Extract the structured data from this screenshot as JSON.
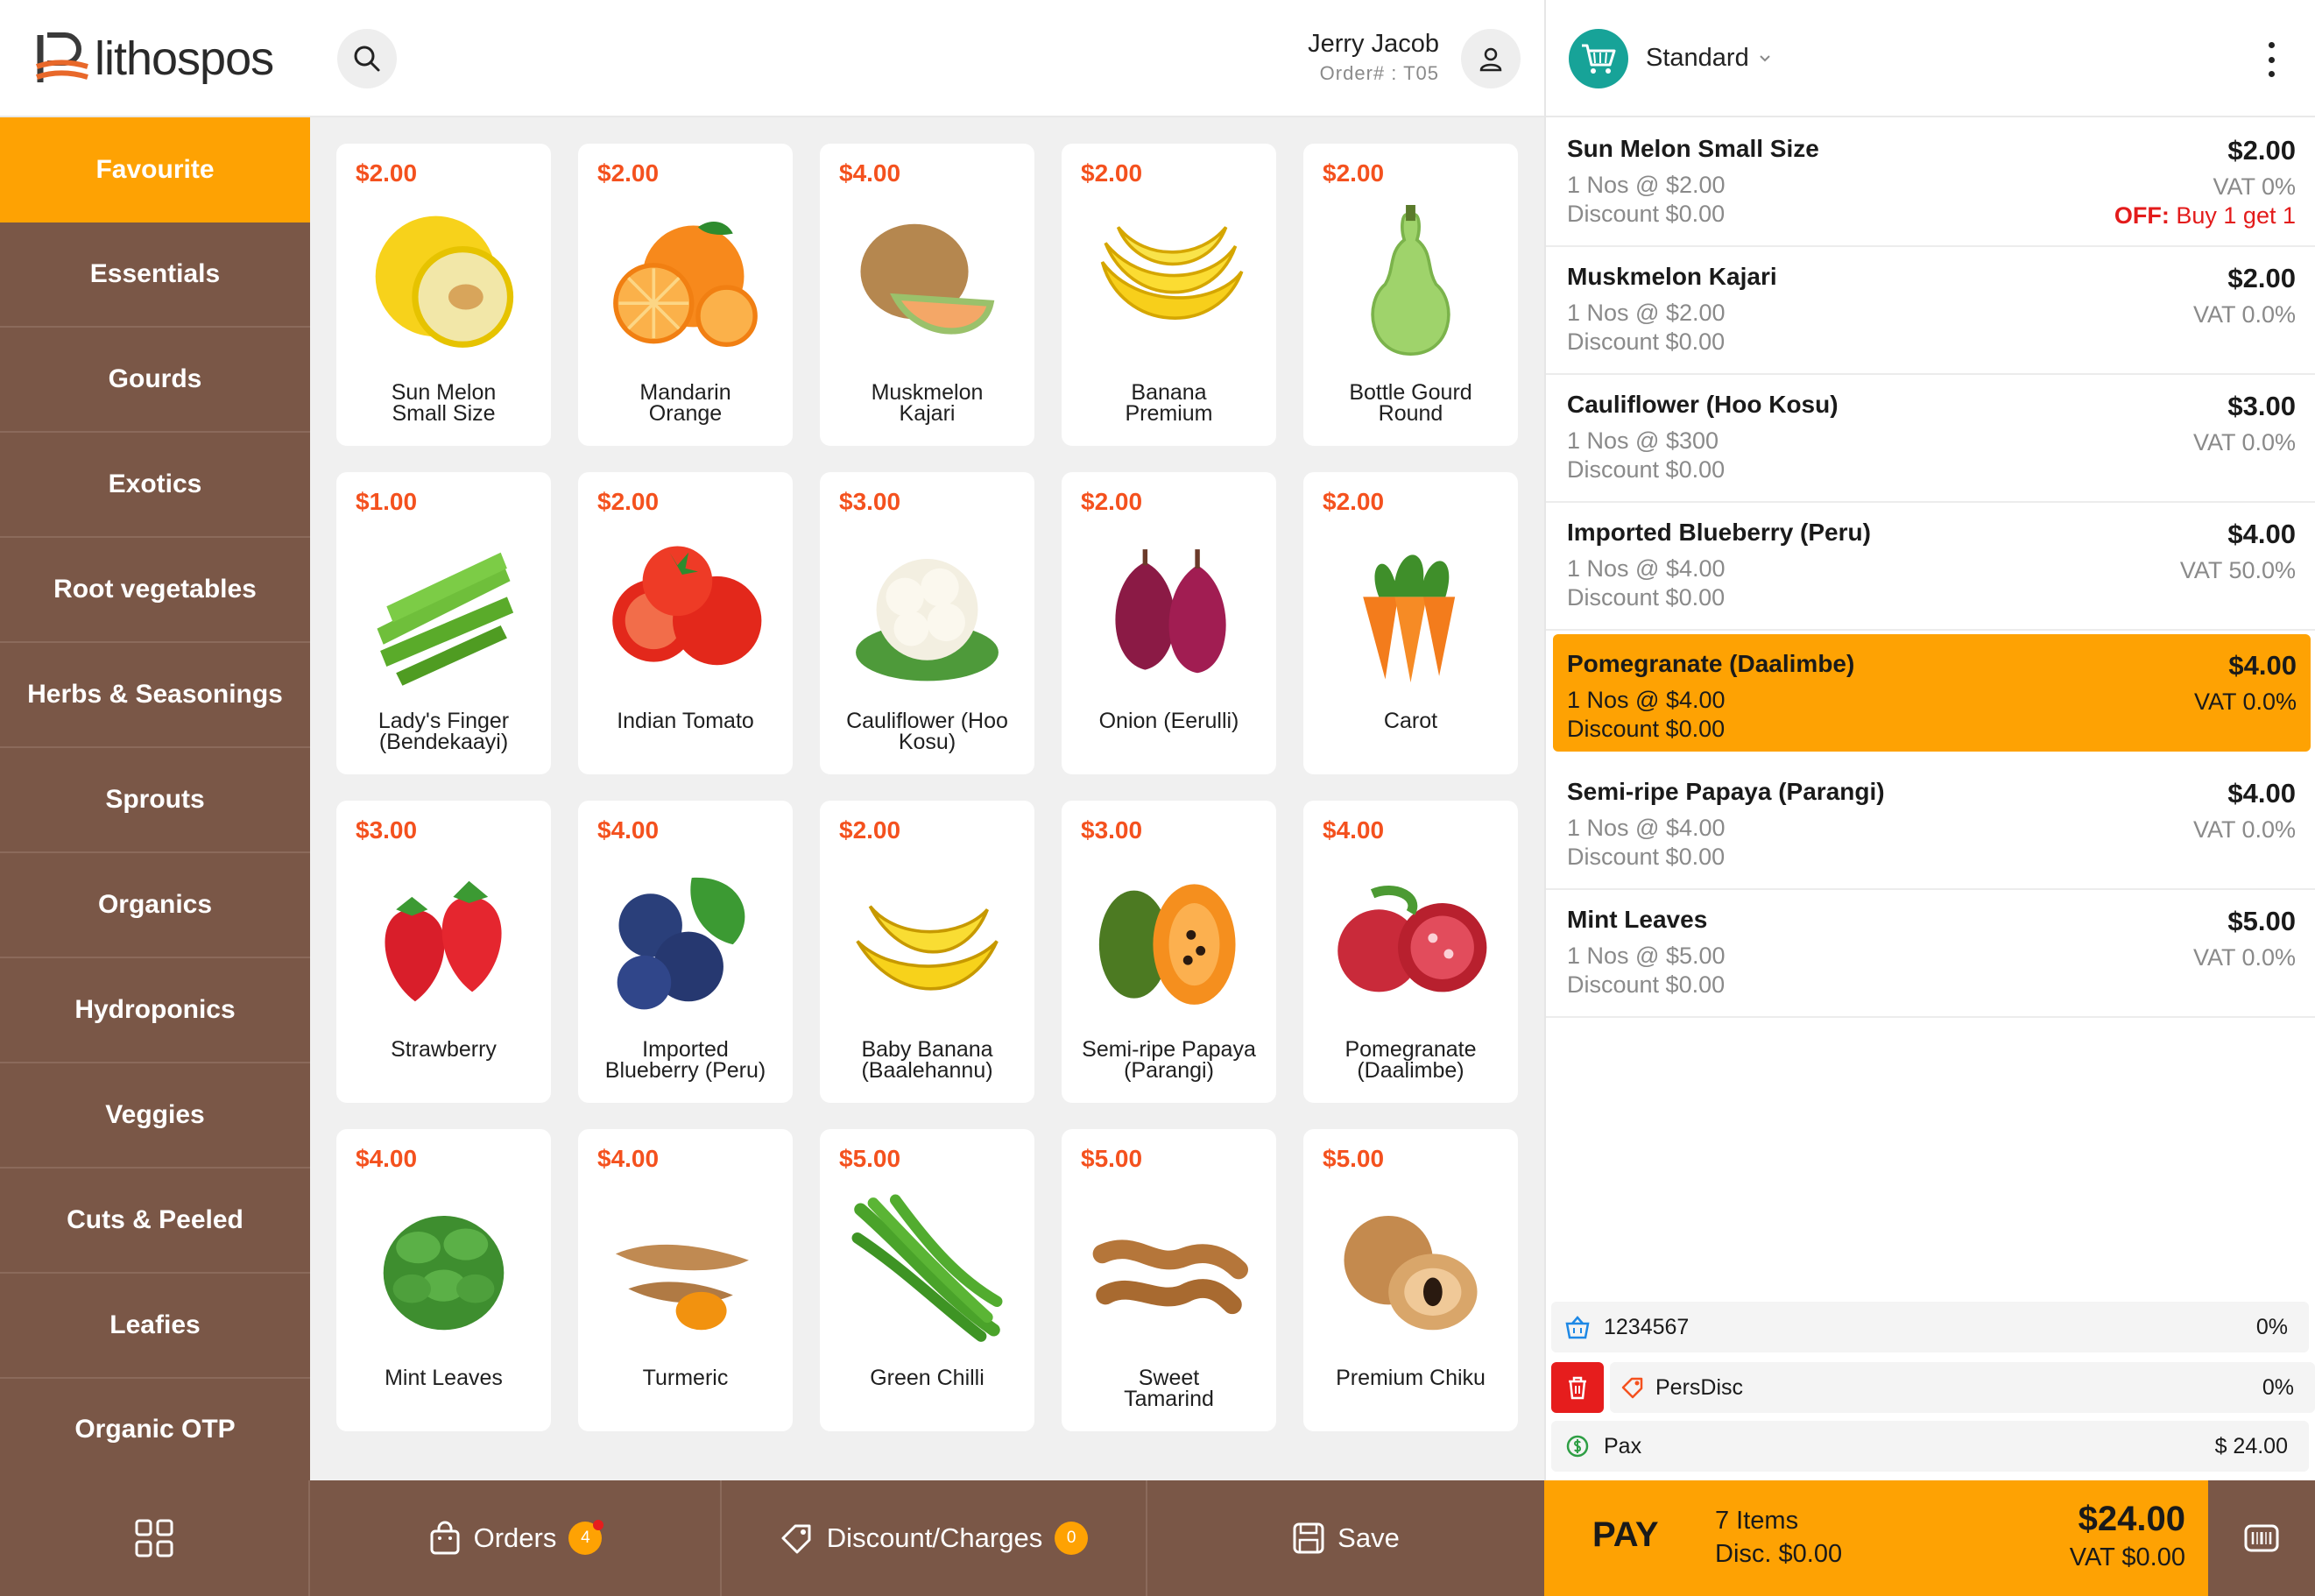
{
  "brand": {
    "name": "lithospos",
    "logo_color": "#e8682a"
  },
  "header": {
    "user_name": "Jerry Jacob",
    "order_no": "Order# : T05",
    "search_icon": "search-icon",
    "user_icon": "user-icon"
  },
  "sidebar": {
    "items": [
      {
        "label": "Favourite",
        "active": true
      },
      {
        "label": "Essentials"
      },
      {
        "label": "Gourds"
      },
      {
        "label": "Exotics"
      },
      {
        "label": "Root vegetables"
      },
      {
        "label": "Herbs & Seasonings"
      },
      {
        "label": "Sprouts"
      },
      {
        "label": "Organics"
      },
      {
        "label": "Hydroponics"
      },
      {
        "label": "Veggies"
      },
      {
        "label": "Cuts & Peeled"
      },
      {
        "label": "Leafies"
      },
      {
        "label": "Organic OTP"
      }
    ]
  },
  "products": [
    {
      "price": "$2.00",
      "name": "Sun Melon\nSmall Size",
      "icon": "sun-melon"
    },
    {
      "price": "$2.00",
      "name": "Mandarin\nOrange",
      "icon": "orange"
    },
    {
      "price": "$4.00",
      "name": "Muskmelon\nKajari",
      "icon": "muskmelon"
    },
    {
      "price": "$2.00",
      "name": "Banana\nPremium",
      "icon": "banana"
    },
    {
      "price": "$2.00",
      "name": "Bottle Gourd\nRound",
      "icon": "bottle-gourd"
    },
    {
      "price": "$1.00",
      "name": "Lady's Finger\n(Bendekaayi)",
      "icon": "okra"
    },
    {
      "price": "$2.00",
      "name": "Indian Tomato",
      "icon": "tomato"
    },
    {
      "price": "$3.00",
      "name": "Cauliflower (Hoo\nKosu)",
      "icon": "cauliflower"
    },
    {
      "price": "$2.00",
      "name": "Onion (Eerulli)",
      "icon": "onion"
    },
    {
      "price": "$2.00",
      "name": "Carot",
      "icon": "carrot"
    },
    {
      "price": "$3.00",
      "name": "Strawberry",
      "icon": "strawberry"
    },
    {
      "price": "$4.00",
      "name": "Imported\nBlueberry (Peru)",
      "icon": "blueberry"
    },
    {
      "price": "$2.00",
      "name": "Baby Banana\n(Baalehannu)",
      "icon": "baby-banana"
    },
    {
      "price": "$3.00",
      "name": "Semi-ripe Papaya\n(Parangi)",
      "icon": "papaya"
    },
    {
      "price": "$4.00",
      "name": "Pomegranate\n(Daalimbe)",
      "icon": "pomegranate"
    },
    {
      "price": "$4.00",
      "name": "Mint Leaves",
      "icon": "mint"
    },
    {
      "price": "$4.00",
      "name": "Turmeric",
      "icon": "turmeric"
    },
    {
      "price": "$5.00",
      "name": "Green Chilli",
      "icon": "chilli"
    },
    {
      "price": "$5.00",
      "name": "Sweet\nTamarind",
      "icon": "tamarind"
    },
    {
      "price": "$5.00",
      "name": "Premium Chiku",
      "icon": "chiku"
    }
  ],
  "cart_header": {
    "pricelist": "Standard",
    "cart_icon": "cart-icon",
    "menu_icon": "more-vert-icon"
  },
  "cart_lines": [
    {
      "name": "Sun Melon Small Size",
      "qty": "1 Nos @ $2.00",
      "discount": "Discount $0.00",
      "amount": "$2.00",
      "vat": "VAT 0%",
      "offer_prefix": "OFF:",
      "offer_text": " Buy 1 get 1"
    },
    {
      "name": "Muskmelon Kajari",
      "qty": "1 Nos @ $2.00",
      "discount": "Discount $0.00",
      "amount": "$2.00",
      "vat": "VAT 0.0%"
    },
    {
      "name": "Cauliflower (Hoo Kosu)",
      "qty": "1 Nos @ $300",
      "discount": "Discount $0.00",
      "amount": "$3.00",
      "vat": "VAT 0.0%"
    },
    {
      "name": "Imported Blueberry (Peru)",
      "qty": "1 Nos @ $4.00",
      "discount": "Discount $0.00",
      "amount": "$4.00",
      "vat": "VAT 50.0%"
    },
    {
      "name": "Pomegranate (Daalimbe)",
      "qty": "1 Nos @ $4.00",
      "discount": "Discount $0.00",
      "amount": "$4.00",
      "vat": "VAT 0.0%",
      "selected": true
    },
    {
      "name": "Semi-ripe Papaya (Parangi)",
      "qty": "1 Nos @ $4.00",
      "discount": "Discount $0.00",
      "amount": "$4.00",
      "vat": "VAT 0.0%"
    },
    {
      "name": "Mint Leaves",
      "qty": "1 Nos @ $5.00",
      "discount": "Discount $0.00",
      "amount": "$5.00",
      "vat": "VAT 0.0%"
    }
  ],
  "summary": {
    "customer": {
      "label": "1234567",
      "value": "0%",
      "icon": "customer-basket-icon"
    },
    "pers_disc": {
      "label": "PersDisc",
      "value": "0%",
      "icon": "discount-tag-icon"
    },
    "pax": {
      "label": "Pax",
      "value": "$ 24.00",
      "icon": "dollar-circle-icon"
    }
  },
  "bottom": {
    "home_icon": "grid-icon",
    "orders_label": "Orders",
    "orders_count": "4",
    "discount_label": "Discount/Charges",
    "discount_count": "0",
    "save_label": "Save"
  },
  "pay": {
    "label": "PAY",
    "items": "7 Items",
    "disc": "Disc. $0.00",
    "total": "$24.00",
    "vat": "VAT $0.00",
    "scan_icon": "barcode-scanner-icon"
  },
  "colors": {
    "accent": "#fea203",
    "brown": "#7a5747",
    "price": "#f4511e",
    "offer": "#e31b1b",
    "teal": "#17a398"
  }
}
